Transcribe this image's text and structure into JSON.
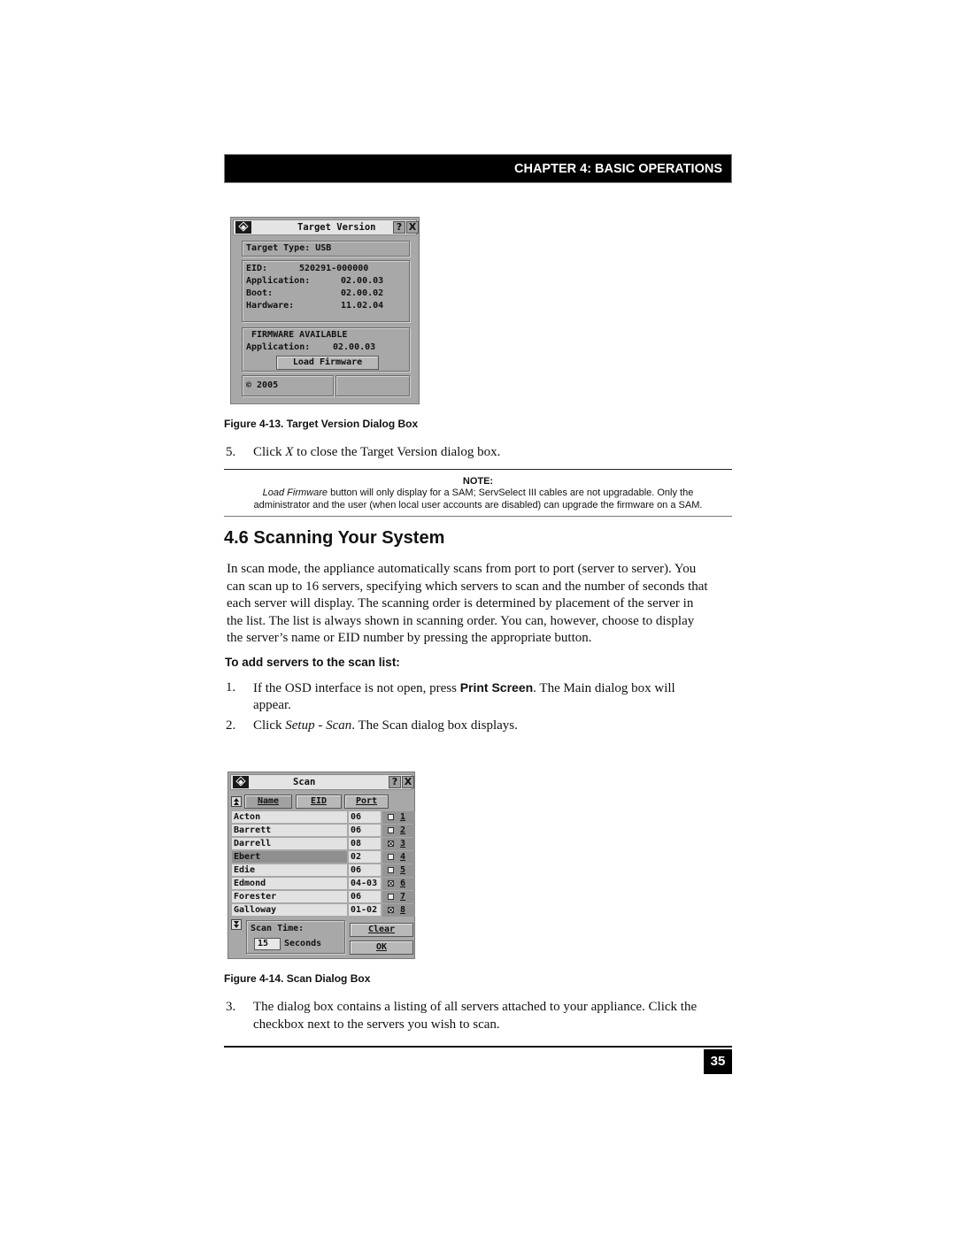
{
  "header": {
    "chapter": "CHAPTER 4: BASIC OPERATIONS"
  },
  "figure13": {
    "caption": "Figure 4-13.  Target Version Dialog Box",
    "dialog": {
      "title": "Target Version",
      "help_button": "?",
      "close_button": "X",
      "target_type": "Target Type: USB",
      "info": [
        {
          "label": "EID:",
          "value": "520291-000000"
        },
        {
          "label": "Application:",
          "value": "02.00.03"
        },
        {
          "label": "Boot:",
          "value": "02.00.02"
        },
        {
          "label": "Hardware:",
          "value": "11.02.04"
        }
      ],
      "firmware_heading": "FIRMWARE AVAILABLE",
      "firmware_label": "Application:",
      "firmware_value": "02.00.03",
      "load_button": "Load Firmware",
      "copyright": "© 2005"
    }
  },
  "step5": {
    "num": "5.",
    "text_pre": "Click ",
    "text_em": "X",
    "text_post": " to close the Target Version dialog box."
  },
  "note": {
    "heading": "NOTE:",
    "line1_em": "Load Firmware",
    "line1_rest": " button will only display for a SAM; ServSelect III cables are not upgradable. Only the",
    "line2": "administrator and the user (when local user accounts are disabled) can upgrade the firmware on a SAM."
  },
  "section": {
    "title": "4.6  Scanning Your System",
    "paragraph": [
      "In scan mode, the appliance automatically scans from port to port (server to server). You",
      "can scan up to 16 servers, specifying which servers to scan and the number of seconds that",
      "each server will display. The scanning order is determined by placement of the server in",
      "the list. The list is always shown in scanning order. You can, however, choose to display",
      "the server’s name or EID number by pressing the appropriate button."
    ],
    "subheading": "To add servers to the scan list:",
    "steps": [
      {
        "num": "1.",
        "pre": "If the OSD interface is not open, press ",
        "bold": "Print Screen",
        "post": ". The Main dialog box will",
        "line2": "appear."
      },
      {
        "num": "2.",
        "pre": "Click ",
        "em": "Setup - Scan",
        "post": ". The Scan dialog box displays."
      }
    ]
  },
  "figure14": {
    "caption": "Figure 4-14.  Scan Dialog Box",
    "dialog": {
      "title": "Scan",
      "help_button": "?",
      "close_button": "X",
      "columns": [
        "Name",
        "EID",
        "Port"
      ],
      "rows": [
        {
          "name": "Acton",
          "eid": "06",
          "checked": false,
          "port": "1",
          "selected": false
        },
        {
          "name": "Barrett",
          "eid": "06",
          "checked": false,
          "port": "2",
          "selected": false
        },
        {
          "name": "Darrell",
          "eid": "08",
          "checked": true,
          "port": "3",
          "selected": false
        },
        {
          "name": "Ebert",
          "eid": "02",
          "checked": false,
          "port": "4",
          "selected": true
        },
        {
          "name": "Edie",
          "eid": "06",
          "checked": false,
          "port": "5",
          "selected": false
        },
        {
          "name": "Edmond",
          "eid": "04-03",
          "checked": true,
          "port": "6",
          "selected": false
        },
        {
          "name": "Forester",
          "eid": "06",
          "checked": false,
          "port": "7",
          "selected": false
        },
        {
          "name": "Galloway",
          "eid": "01-02",
          "checked": true,
          "port": "8",
          "selected": false
        }
      ],
      "scan_time_label": "Scan Time:",
      "scan_time_value": "15",
      "seconds_label": "Seconds",
      "clear_button": "Clear",
      "ok_button": "OK"
    }
  },
  "step3": {
    "num": "3.",
    "line1": "The dialog box contains a listing of all servers attached to your appliance. Click the",
    "line2": "checkbox next to the servers you wish to scan."
  },
  "footer": {
    "page_number": "35"
  }
}
